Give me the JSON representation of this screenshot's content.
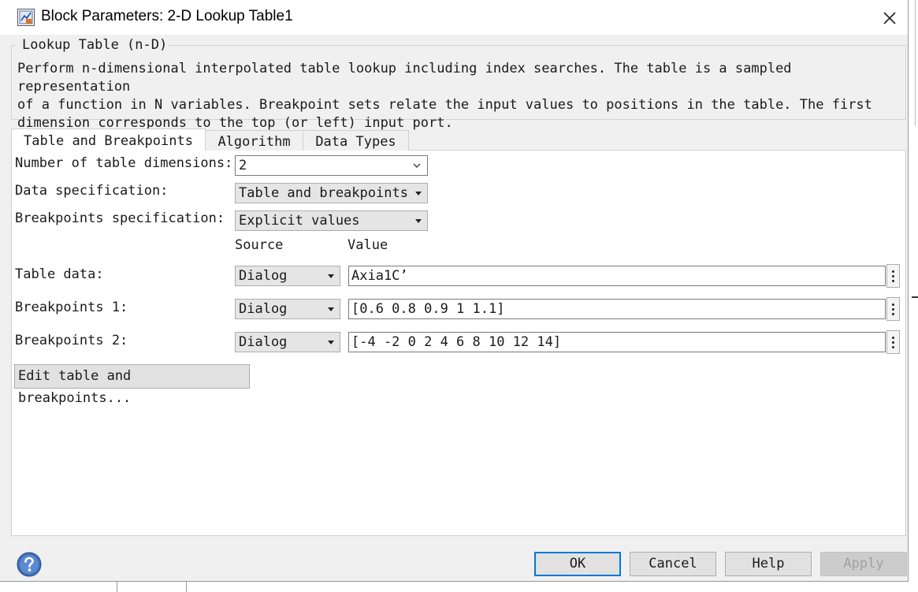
{
  "window": {
    "title": "Block Parameters: 2-D Lookup Table1"
  },
  "group": {
    "title": "Lookup Table (n-D)",
    "description": "Perform n-dimensional interpolated table lookup including index searches. The table is a sampled representation\nof a function in N variables. Breakpoint sets relate the input values to positions in the table. The first\ndimension corresponds to the top (or left) input port."
  },
  "tabs": [
    {
      "label": "Table and Breakpoints",
      "active": true
    },
    {
      "label": "Algorithm",
      "active": false
    },
    {
      "label": "Data Types",
      "active": false
    }
  ],
  "form": {
    "num_dims_label": "Number of table dimensions:",
    "num_dims_value": "2",
    "data_spec_label": "Data specification:",
    "data_spec_value": "Table and breakpoints",
    "bp_spec_label": "Breakpoints specification:",
    "bp_spec_value": "Explicit values",
    "source_header": "Source",
    "value_header": "Value",
    "rows": [
      {
        "label": "Table data:",
        "source": "Dialog",
        "value": "Axia1C’"
      },
      {
        "label": "Breakpoints 1:",
        "source": "Dialog",
        "value": "[0.6 0.8 0.9 1 1.1]"
      },
      {
        "label": "Breakpoints 2:",
        "source": "Dialog",
        "value": "[-4 -2 0 2 4 6 8 10 12 14]"
      }
    ],
    "edit_button": "Edit table and breakpoints..."
  },
  "buttons": {
    "ok": "OK",
    "cancel": "Cancel",
    "help": "Help",
    "apply": "Apply"
  },
  "icons": {
    "app": "simulink-block-icon",
    "close": "close-icon",
    "help": "help-question-icon",
    "more": "vertical-ellipsis-icon"
  },
  "colors": {
    "default_button_border": "#0078d7",
    "help_icon": "#3f6fb5"
  }
}
